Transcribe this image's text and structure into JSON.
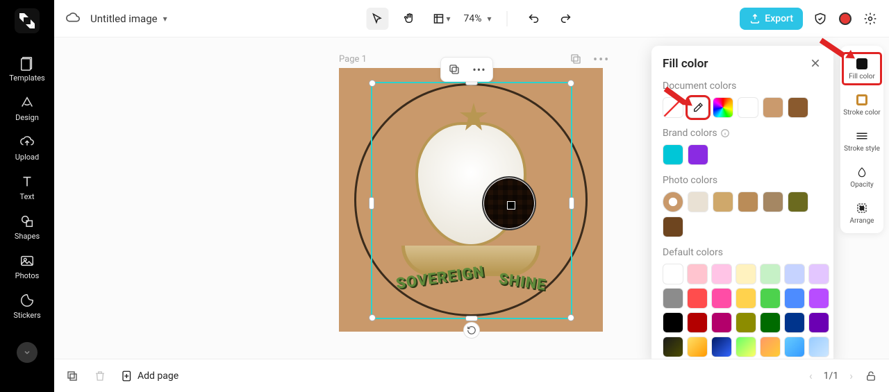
{
  "header": {
    "title": "Untitled image",
    "zoom": "74%",
    "export_label": "Export"
  },
  "sidebar": {
    "items": [
      {
        "label": "Templates"
      },
      {
        "label": "Design"
      },
      {
        "label": "Upload"
      },
      {
        "label": "Text"
      },
      {
        "label": "Shapes"
      },
      {
        "label": "Photos"
      },
      {
        "label": "Stickers"
      }
    ]
  },
  "canvas": {
    "page_label": "Page 1",
    "arc_text_1": "SOVEREIGN",
    "arc_text_2": "SHINE"
  },
  "fill_panel": {
    "title": "Fill color",
    "sections": {
      "document": "Document colors",
      "brand": "Brand colors",
      "photo": "Photo colors",
      "default": "Default colors"
    },
    "document_colors": [
      "#ffffff",
      "#ca9a6d",
      "#8a5a2e"
    ],
    "brand_colors": [
      "#00c6d7",
      "#8a2be2"
    ],
    "photo_colors": [
      "#e9e1d4",
      "#cfa86b",
      "#ba8c58",
      "#a58763",
      "#6b6a1f",
      "#6e451f"
    ],
    "default_colors": [
      "#ffffff",
      "#ffc4cf",
      "#ffc4e6",
      "#fff2bf",
      "#c6f1c6",
      "#c6d3ff",
      "#e3c6ff",
      "#8c8c8c",
      "#ff4d4d",
      "#ff4da6",
      "#ffd24d",
      "#4dd24d",
      "#4d8cff",
      "#b84dff",
      "#000000",
      "#b30000",
      "#b3006b",
      "#8c8c00",
      "#006b00",
      "#00348c",
      "#6b00b3"
    ],
    "gradient_colors": [
      "#1a1a1a-#4d4d00",
      "#ffe066-#ff9900",
      "#001a66-#3366ff",
      "#66ff66-#ffff66",
      "#ff9966-#ffcc33",
      "#66ccff-#3399ff",
      "#99ccff-#cce6ff"
    ]
  },
  "right_rail": {
    "items": [
      {
        "label": "Fill color"
      },
      {
        "label": "Stroke color"
      },
      {
        "label": "Stroke style"
      },
      {
        "label": "Opacity"
      },
      {
        "label": "Arrange"
      }
    ]
  },
  "bottom": {
    "add_page": "Add page",
    "pager": "1/1"
  }
}
